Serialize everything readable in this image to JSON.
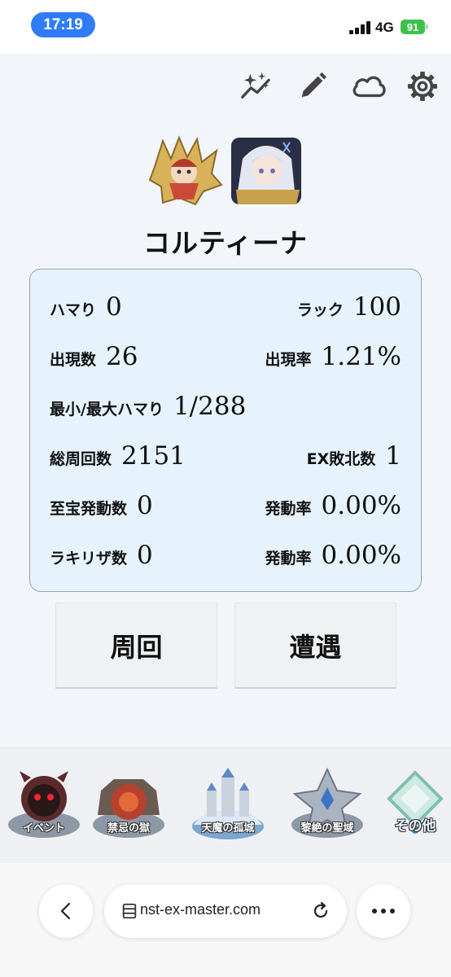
{
  "status_bar": {
    "time": "17:19",
    "network": "4G",
    "battery": "91"
  },
  "toolbar": {
    "icons": [
      "sparkle-chart-icon",
      "pencil-icon",
      "cloud-icon",
      "gear-icon"
    ]
  },
  "character": {
    "name": "コルティーナ"
  },
  "stats": {
    "hamari_label": "ハマり",
    "hamari_value": "0",
    "luck_label": "ラック",
    "luck_value": "100",
    "appear_count_label": "出現数",
    "appear_count_value": "26",
    "appear_rate_label": "出現率",
    "appear_rate_value": "1.21%",
    "minmax_label": "最小/最大ハマり",
    "minmax_value": "1/288",
    "total_runs_label": "総周回数",
    "total_runs_value": "2151",
    "ex_defeat_label": "EX敗北数",
    "ex_defeat_value": "1",
    "treasure_label": "至宝発動数",
    "treasure_value": "0",
    "treasure_rate_label": "発動率",
    "treasure_rate_value": "0.00%",
    "rakirisa_label": "ラキリザ数",
    "rakirisa_value": "0",
    "rakirisa_rate_label": "発動率",
    "rakirisa_rate_value": "0.00%"
  },
  "actions": {
    "run_label": "周回",
    "encounter_label": "遭遇"
  },
  "dungeons": [
    {
      "label": "イベント",
      "icon": "event-icon"
    },
    {
      "label": "禁忌の獄",
      "icon": "forbidden-prison-icon"
    },
    {
      "label": "天魔の孤城",
      "icon": "tenma-castle-icon"
    },
    {
      "label": "黎絶の聖域",
      "icon": "reizetsu-sanctuary-icon"
    },
    {
      "label": "その他",
      "icon": "other-icon"
    }
  ],
  "browser": {
    "url": "nst-ex-master.com"
  },
  "colors": {
    "accent": "#2f7cf6",
    "panel_bg": "#e6f3fd",
    "battery": "#3ec14a"
  }
}
